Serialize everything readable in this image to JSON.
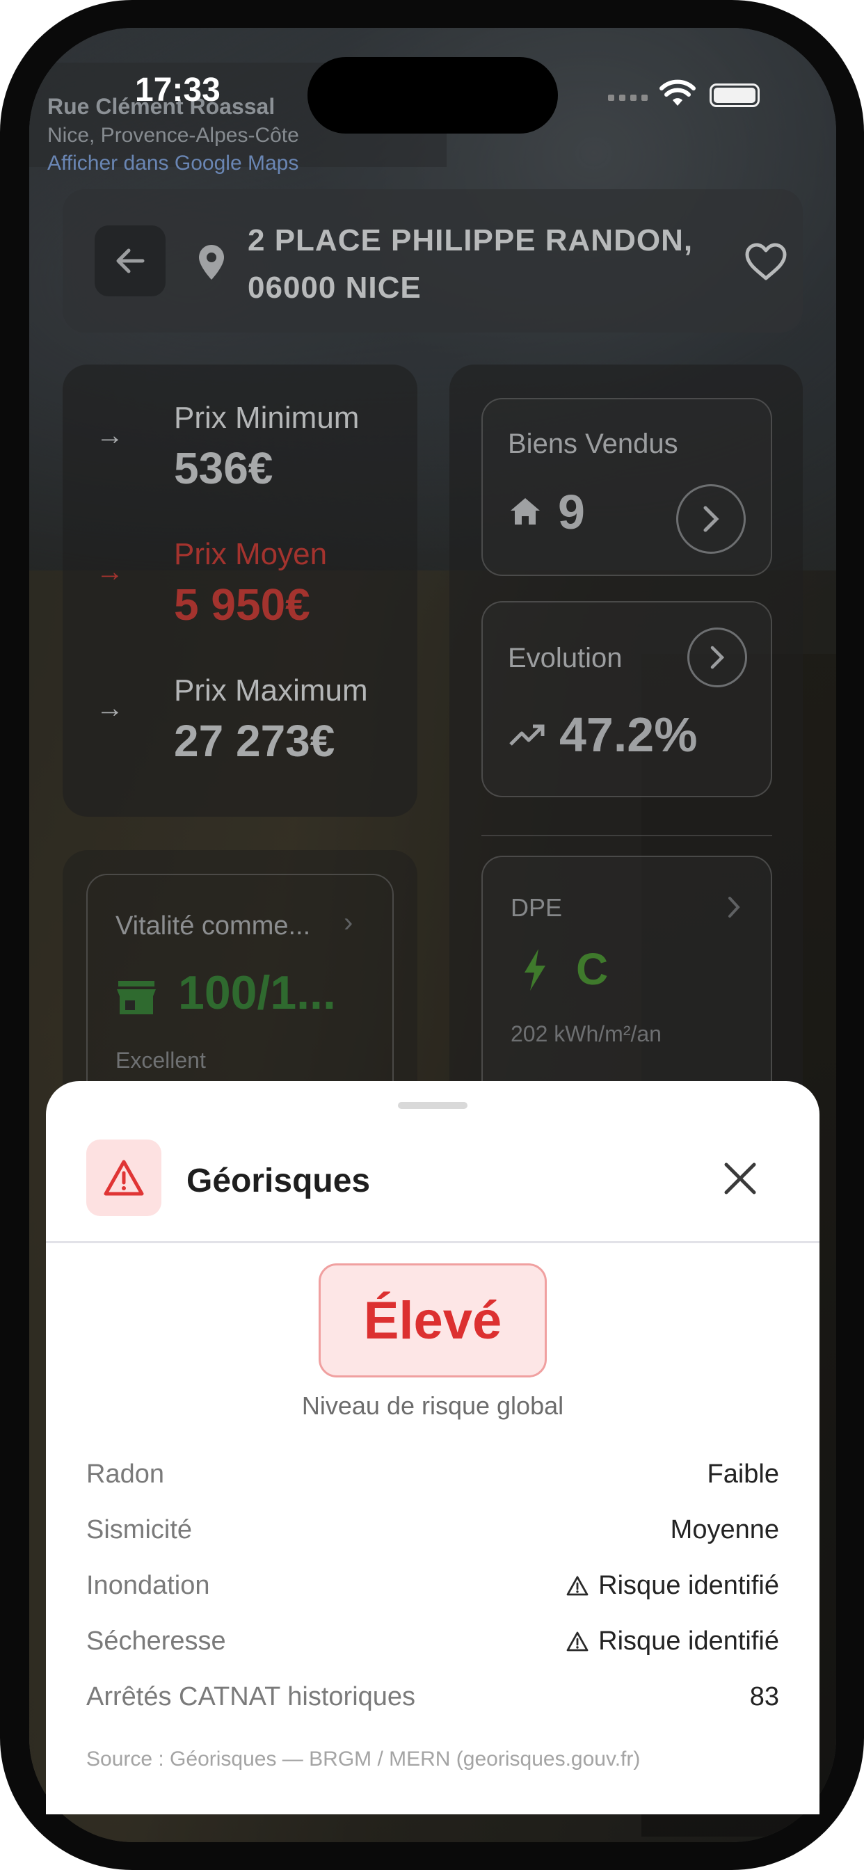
{
  "status_bar": {
    "time": "17:33"
  },
  "map_overlay": {
    "street": "Rue Clément Roassal",
    "region": "Nice, Provence-Alpes-Côte",
    "link": "Afficher dans Google Maps"
  },
  "address": {
    "text": "2 PLACE PHILIPPE RANDON, 06000 NICE"
  },
  "prices": [
    {
      "label": "Prix Minimum",
      "value": "536€"
    },
    {
      "label": "Prix Moyen",
      "value": "5 950€"
    },
    {
      "label": "Prix Maximum",
      "value": "27 273€"
    }
  ],
  "biens_vendus": {
    "title": "Biens Vendus",
    "value": "9"
  },
  "evolution": {
    "title": "Evolution",
    "value": "47.2%"
  },
  "dpe": {
    "title": "DPE",
    "grade": "C",
    "detail": "202 kWh/m²/an"
  },
  "vitalite": {
    "title": "Vitalité comme...",
    "score": "100/1...",
    "note": "Excellent"
  },
  "sheet": {
    "title": "Géorisques",
    "level": "Élevé",
    "level_caption": "Niveau de risque global",
    "rows": [
      {
        "key": "Radon",
        "value": "Faible",
        "warning": false
      },
      {
        "key": "Sismicité",
        "value": "Moyenne",
        "warning": false
      },
      {
        "key": "Inondation",
        "value": "Risque identifié",
        "warning": true
      },
      {
        "key": "Sécheresse",
        "value": "Risque identifié",
        "warning": true
      },
      {
        "key": "Arrêtés CATNAT historiques",
        "value": "83",
        "warning": false
      }
    ],
    "source": "Source : Géorisques — BRGM / MERN (georisques.gouv.fr)"
  },
  "colors": {
    "risk_red": "#dc3030",
    "price_red": "#a4332e",
    "dpe_green": "#3f7a2c"
  }
}
